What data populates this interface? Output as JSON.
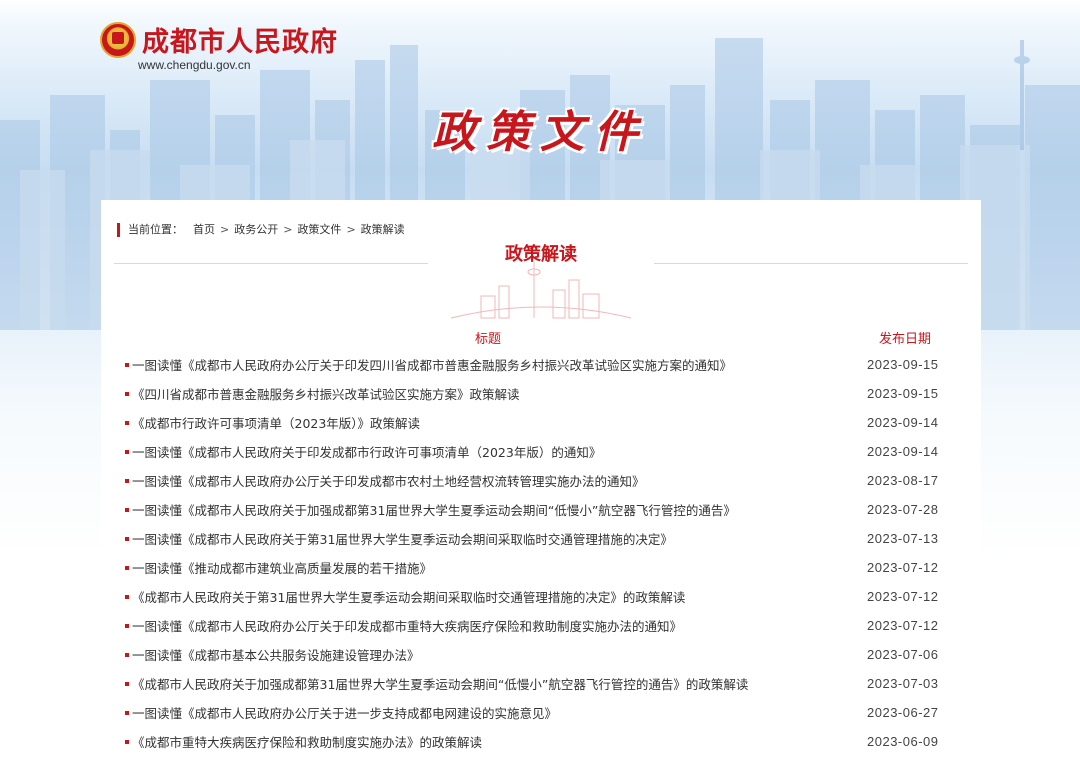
{
  "header": {
    "site_name": "成都市人民政府",
    "site_url": "www.chengdu.gov.cn",
    "banner_title": "政策文件"
  },
  "breadcrumb": {
    "label": "当前位置：",
    "items": [
      "首页",
      "政务公开",
      "政策文件",
      "政策解读"
    ],
    "separator": ">"
  },
  "section": {
    "title": "政策解读",
    "col_title": "标题",
    "col_date": "发布日期"
  },
  "colors": {
    "accent": "#c8161d",
    "text": "#333333",
    "divider": "#d9d9d9"
  },
  "rows": [
    {
      "title": "一图读懂《成都市人民政府办公厅关于印发四川省成都市普惠金融服务乡村振兴改革试验区实施方案的通知》",
      "date": "2023-09-15"
    },
    {
      "title": "《四川省成都市普惠金融服务乡村振兴改革试验区实施方案》政策解读",
      "date": "2023-09-15"
    },
    {
      "title": "《成都市行政许可事项清单（2023年版）》政策解读",
      "date": "2023-09-14"
    },
    {
      "title": "一图读懂《成都市人民政府关于印发成都市行政许可事项清单（2023年版）的通知》",
      "date": "2023-09-14"
    },
    {
      "title": "一图读懂《成都市人民政府办公厅关于印发成都市农村土地经营权流转管理实施办法的通知》",
      "date": "2023-08-17"
    },
    {
      "title": "一图读懂《成都市人民政府关于加强成都第31届世界大学生夏季运动会期间“低慢小”航空器飞行管控的通告》",
      "date": "2023-07-28"
    },
    {
      "title": "一图读懂《成都市人民政府关于第31届世界大学生夏季运动会期间采取临时交通管理措施的决定》",
      "date": "2023-07-13"
    },
    {
      "title": "一图读懂《推动成都市建筑业高质量发展的若干措施》",
      "date": "2023-07-12"
    },
    {
      "title": "《成都市人民政府关于第31届世界大学生夏季运动会期间采取临时交通管理措施的决定》的政策解读",
      "date": "2023-07-12"
    },
    {
      "title": "一图读懂《成都市人民政府办公厅关于印发成都市重特大疾病医疗保险和救助制度实施办法的通知》",
      "date": "2023-07-12"
    },
    {
      "title": "一图读懂《成都市基本公共服务设施建设管理办法》",
      "date": "2023-07-06"
    },
    {
      "title": "《成都市人民政府关于加强成都第31届世界大学生夏季运动会期间“低慢小”航空器飞行管控的通告》的政策解读",
      "date": "2023-07-03"
    },
    {
      "title": "一图读懂《成都市人民政府办公厅关于进一步支持成都电网建设的实施意见》",
      "date": "2023-06-27"
    },
    {
      "title": "《成都市重特大疾病医疗保险和救助制度实施办法》的政策解读",
      "date": "2023-06-09"
    }
  ]
}
